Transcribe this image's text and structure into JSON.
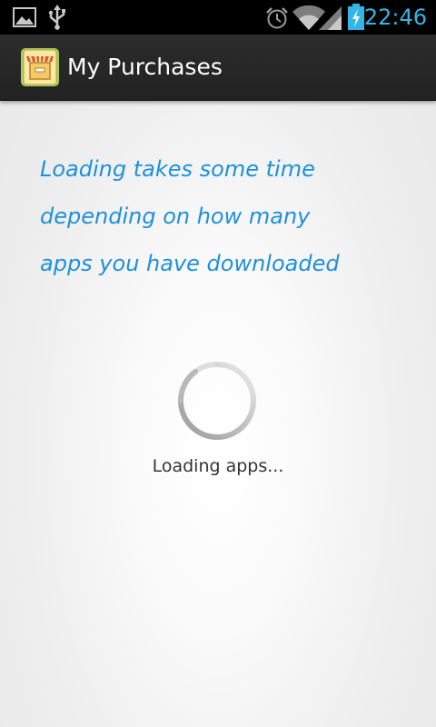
{
  "status_bar": {
    "time": "22:46",
    "icons": [
      "gallery-notification-icon",
      "usb-icon",
      "alarm-clock-icon",
      "wifi-icon",
      "signal-icon",
      "battery-charging-icon"
    ],
    "accent_color": "#33b5e5"
  },
  "action_bar": {
    "title": "My Purchases",
    "app_icon": "store-icon"
  },
  "content": {
    "hint_lines": [
      "Loading takes some time",
      "depending on how many",
      "apps you have downloaded"
    ],
    "hint_color": "#1e90dc",
    "loading_label": "Loading apps...",
    "spinner_icon": "progress-spinner-icon"
  }
}
